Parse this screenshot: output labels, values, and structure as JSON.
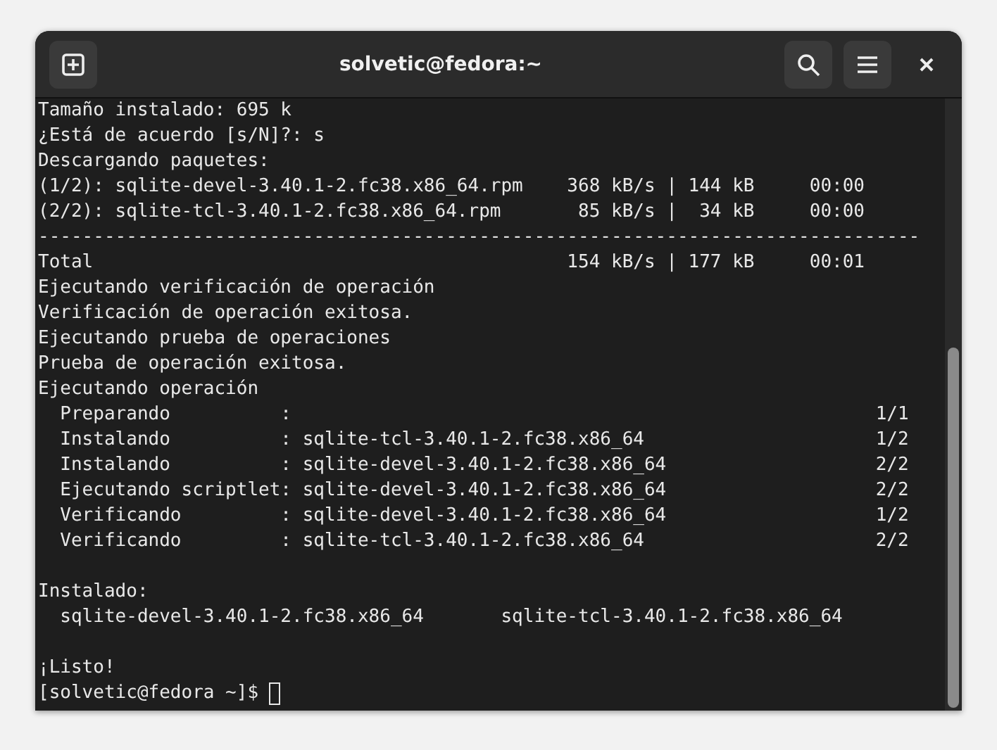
{
  "window": {
    "title": "solvetic@fedora:~"
  },
  "terminal": {
    "lines": [
      {
        "kind": "text",
        "text": "Tamaño instalado: 695 k"
      },
      {
        "kind": "text",
        "text": "¿Está de acuerdo [s/N]?: s"
      },
      {
        "kind": "text",
        "text": "Descargando paquetes:"
      },
      {
        "kind": "text",
        "text": "(1/2): sqlite-devel-3.40.1-2.fc38.x86_64.rpm    368 kB/s | 144 kB     00:00"
      },
      {
        "kind": "text",
        "text": "(2/2): sqlite-tcl-3.40.1-2.fc38.x86_64.rpm       85 kB/s |  34 kB     00:00"
      },
      {
        "kind": "text",
        "text": "--------------------------------------------------------------------------------"
      },
      {
        "kind": "text",
        "text": "Total                                           154 kB/s | 177 kB     00:01"
      },
      {
        "kind": "text",
        "text": "Ejecutando verificación de operación"
      },
      {
        "kind": "text",
        "text": "Verificación de operación exitosa."
      },
      {
        "kind": "text",
        "text": "Ejecutando prueba de operaciones"
      },
      {
        "kind": "text",
        "text": "Prueba de operación exitosa."
      },
      {
        "kind": "text",
        "text": "Ejecutando operación"
      },
      {
        "kind": "text",
        "text": "  Preparando          :                                                     1/1"
      },
      {
        "kind": "text",
        "text": "  Instalando          : sqlite-tcl-3.40.1-2.fc38.x86_64                     1/2"
      },
      {
        "kind": "text",
        "text": "  Instalando          : sqlite-devel-3.40.1-2.fc38.x86_64                   2/2"
      },
      {
        "kind": "text",
        "text": "  Ejecutando scriptlet: sqlite-devel-3.40.1-2.fc38.x86_64                   2/2"
      },
      {
        "kind": "text",
        "text": "  Verificando         : sqlite-devel-3.40.1-2.fc38.x86_64                   1/2"
      },
      {
        "kind": "text",
        "text": "  Verificando         : sqlite-tcl-3.40.1-2.fc38.x86_64                     2/2"
      },
      {
        "kind": "blank"
      },
      {
        "kind": "text",
        "text": "Instalado:"
      },
      {
        "kind": "text",
        "text": "  sqlite-devel-3.40.1-2.fc38.x86_64       sqlite-tcl-3.40.1-2.fc38.x86_64"
      },
      {
        "kind": "blank"
      },
      {
        "kind": "text",
        "text": "¡Listo!"
      },
      {
        "kind": "prompt",
        "text": "[solvetic@fedora ~]$ "
      }
    ]
  }
}
